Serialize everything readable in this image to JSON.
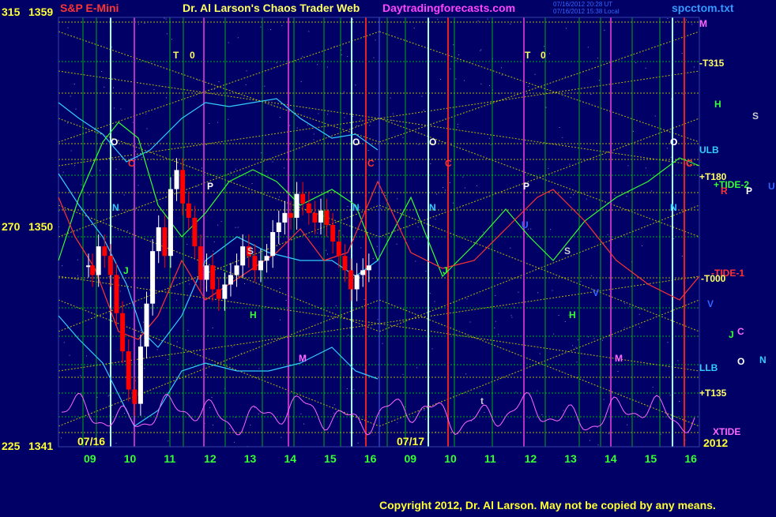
{
  "header": {
    "symbol": "S&P E-Mini",
    "title": "Dr. Al Larson's Chaos Trader Web",
    "site": "Daytradingforecasts.com",
    "stamp1": "07/16/2012 20:28 UT",
    "stamp2": "07/16/2012 15:38 Local",
    "file": "spcctom.txt"
  },
  "copyright": "Copyright 2012, Dr. Al Larson. May not be copied by any means.",
  "colors": {
    "background": "#000066",
    "grid_green": "#00cc00",
    "grid_yellow": "#cccc00",
    "day_divider": "#aaffff",
    "magenta_line": "#cc33cc",
    "red_line": "#ff2222",
    "price_up": "#ffffff",
    "price_down": "#ff0000",
    "xtide": "#ff66ff",
    "cyan_curve": "#33ccff",
    "green_curve": "#33ff33",
    "red_curve": "#ff3333"
  },
  "chart_data": {
    "type": "candlestick",
    "y_axis": {
      "ticks": [
        {
          "degree": "315",
          "price": "1359",
          "value": 1359
        },
        {
          "degree": "270",
          "price": "1350",
          "value": 1350
        },
        {
          "degree": "225",
          "price": "1341",
          "value": 1341
        }
      ],
      "ylim": [
        1341,
        1359
      ]
    },
    "x_axis": {
      "hour_ticks": [
        "09",
        "10",
        "11",
        "12",
        "13",
        "14",
        "15",
        "16",
        "09",
        "10",
        "11",
        "12",
        "13",
        "14",
        "15",
        "16"
      ],
      "date_labels": [
        "07/16",
        "07/17"
      ],
      "year": "2012"
    },
    "right_labels": [
      {
        "text": "M",
        "color": "#ff66ff"
      },
      {
        "text": "-T315",
        "color": "#ffff66"
      },
      {
        "text": "H",
        "color": "#33ff33"
      },
      {
        "text": "S",
        "color": "#cccccc"
      },
      {
        "text": "O",
        "color": "#ffffff"
      },
      {
        "text": "ULB",
        "color": "#33ccff"
      },
      {
        "text": "+T180",
        "color": "#ffff66"
      },
      {
        "text": "C",
        "color": "#ff3333"
      },
      {
        "text": "+TIDE-2",
        "color": "#33ff33"
      },
      {
        "text": "R",
        "color": "#ff3333"
      },
      {
        "text": "P",
        "color": "#ffffff"
      },
      {
        "text": "U",
        "color": "#3366ff"
      },
      {
        "text": "-TIDE-1",
        "color": "#ff3333"
      },
      {
        "text": "-T000",
        "color": "#ffff66"
      },
      {
        "text": "V",
        "color": "#3366ff"
      },
      {
        "text": "C",
        "color": "#ff66ff"
      },
      {
        "text": "J",
        "color": "#33ff33"
      },
      {
        "text": "LLB",
        "color": "#33ccff"
      },
      {
        "text": "O",
        "color": "#ffffff"
      },
      {
        "text": "N",
        "color": "#33ccff"
      },
      {
        "text": "+T135",
        "color": "#ffff66"
      },
      {
        "text": "XTIDE",
        "color": "#ff66ff"
      }
    ],
    "chart_letters": [
      {
        "text": "T",
        "color": "#ffff66"
      },
      {
        "text": "0",
        "color": "#ffff66"
      },
      {
        "text": "T",
        "color": "#ffff66"
      },
      {
        "text": "0",
        "color": "#ffff66"
      },
      {
        "text": "O",
        "color": "#ffffff"
      },
      {
        "text": "O",
        "color": "#ffffff"
      },
      {
        "text": "O",
        "color": "#ffffff"
      },
      {
        "text": "O",
        "color": "#ffffff"
      },
      {
        "text": "C",
        "color": "#ff3333"
      },
      {
        "text": "C",
        "color": "#ff3333"
      },
      {
        "text": "C",
        "color": "#ff3333"
      },
      {
        "text": "C",
        "color": "#ff3333"
      },
      {
        "text": "P",
        "color": "#ffffff"
      },
      {
        "text": "P",
        "color": "#ffffff"
      },
      {
        "text": "N",
        "color": "#33ccff"
      },
      {
        "text": "N",
        "color": "#33ccff"
      },
      {
        "text": "N",
        "color": "#33ccff"
      },
      {
        "text": "N",
        "color": "#33ccff"
      },
      {
        "text": "S",
        "color": "#cccccc"
      },
      {
        "text": "S",
        "color": "#cccccc"
      },
      {
        "text": "H",
        "color": "#33ff33"
      },
      {
        "text": "H",
        "color": "#33ff33"
      },
      {
        "text": "J",
        "color": "#33ff33"
      },
      {
        "text": "J",
        "color": "#33ff33"
      },
      {
        "text": "M",
        "color": "#ff66ff"
      },
      {
        "text": "M",
        "color": "#ff66ff"
      },
      {
        "text": "U",
        "color": "#3366ff"
      },
      {
        "text": "V",
        "color": "#3366ff"
      },
      {
        "text": "t",
        "color": "#cccccc"
      }
    ],
    "price_series": {
      "name": "S&P E-Mini",
      "hours": [
        9.0,
        9.1,
        9.25,
        9.4,
        9.55,
        9.7,
        9.85,
        10.0,
        10.15,
        10.3,
        10.45,
        10.6,
        10.75,
        10.9,
        11.05,
        11.2,
        11.35,
        11.5,
        11.65,
        11.8,
        11.95,
        12.1,
        12.25,
        12.4,
        12.55,
        12.7,
        12.85,
        13.0,
        13.15,
        13.3,
        13.45,
        13.6,
        13.75,
        13.9,
        14.05,
        14.2,
        14.35,
        14.5,
        14.65,
        14.8,
        14.95,
        15.1,
        15.25,
        15.4,
        15.55,
        15.7,
        15.85,
        16.0
      ],
      "close": [
        1348.6,
        1348.2,
        1349.4,
        1349.0,
        1348.2,
        1346.6,
        1345.0,
        1343.4,
        1342.8,
        1345.2,
        1347.0,
        1349.2,
        1350.2,
        1349.0,
        1351.8,
        1352.6,
        1351.2,
        1350.6,
        1349.4,
        1348.0,
        1348.6,
        1347.6,
        1347.2,
        1347.8,
        1348.2,
        1348.6,
        1349.4,
        1349.0,
        1348.4,
        1348.8,
        1349.0,
        1350.0,
        1350.4,
        1350.8,
        1350.6,
        1351.6,
        1351.2,
        1350.8,
        1350.4,
        1350.9,
        1350.3,
        1349.6,
        1349.0,
        1348.4,
        1347.6,
        1348.2,
        1348.4,
        1348.6
      ]
    }
  }
}
